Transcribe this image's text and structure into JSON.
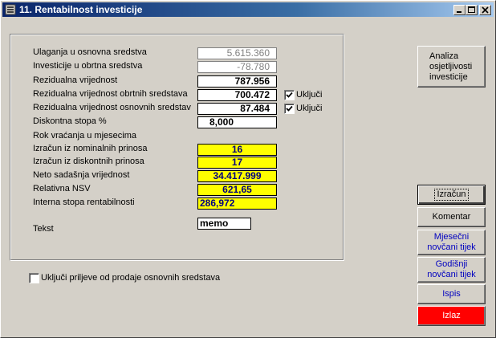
{
  "window": {
    "title": "11. Rentabilnost investicije"
  },
  "fields": [
    {
      "label": "Ulaganja u osnovna sredstva",
      "value": "5.615.360"
    },
    {
      "label": "Investicije u obrtna sredstva",
      "value": "-78.780"
    },
    {
      "label": "Rezidualna vrijednost",
      "value": "787.956"
    },
    {
      "label": "Rezidualna vrijednost obrtnih sredstava",
      "value": "700.472",
      "checkbox_label": "Uključi"
    },
    {
      "label": "Rezidualna vrijednost osnovnih sredstav",
      "value": "87.484",
      "checkbox_label": "Uključi"
    },
    {
      "label": "Diskontna stopa %",
      "value": "8,000"
    }
  ],
  "rok_label": "Rok vraćanja u mjesecima",
  "results": [
    {
      "label": "Izračun iz nominalnih prinosa",
      "value": "16"
    },
    {
      "label": "Izračun iz diskontnih prinosa",
      "value": "17"
    },
    {
      "label": "Neto sadašnja vrijednost",
      "value": "34.417.999"
    },
    {
      "label": "Relativna NSV",
      "value": "621,65"
    },
    {
      "label": "Interna stopa rentabilnosti",
      "value": "286,972"
    }
  ],
  "tekst": {
    "label": "Tekst",
    "value": "memo"
  },
  "bottom_checkbox_label": "Uključi priljeve od prodaje osnovnih sredstava",
  "buttons": {
    "analiza": "Analiza\nosjetljivosti\ninvesticije",
    "izracun": "Izračun",
    "komentar": "Komentar",
    "mjesecni": "Mjesečni\nnovčani tijek",
    "godisnji": "Godišnji\nnovčani tijek",
    "ispis": "Ispis",
    "izlaz": "Izlaz"
  },
  "colors": {
    "titlebar": "#0a246a",
    "result_bg": "#ffff00",
    "result_text": "#00007f",
    "exit_button": "#ff0000",
    "link_button_text": "#0000c0"
  }
}
